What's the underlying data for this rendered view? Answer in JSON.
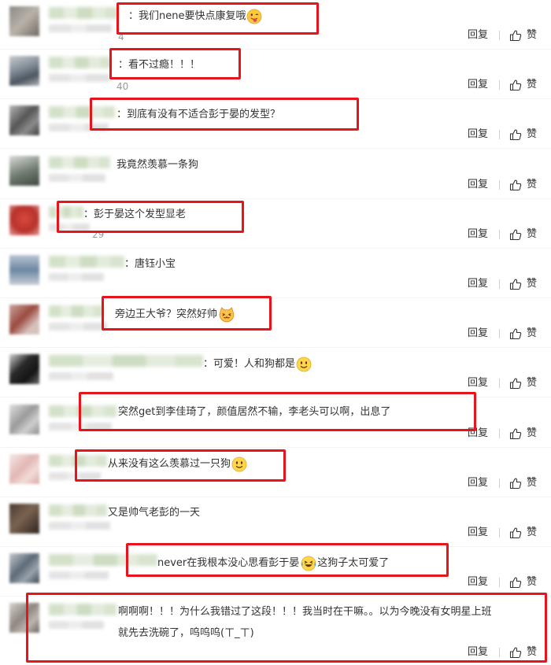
{
  "actions": {
    "reply_label": "回复",
    "like_label": "赞"
  },
  "colors": {
    "highlight": "#e8141b",
    "text": "#333333",
    "meta": "#999999"
  },
  "comments": [
    {
      "text": "：我们nene要快点康复哦",
      "emoji": "tongue-face-icon",
      "time": "4"
    },
    {
      "text": "：看不过瘾！！！",
      "time": "40"
    },
    {
      "text": "：到底有没有不适合彭于晏的发型？"
    },
    {
      "text": "我竟然羡慕一条狗"
    },
    {
      "text": "：彭于晏这个发型显老",
      "time": "29"
    },
    {
      "text": "：唐钰小宝"
    },
    {
      "text": "旁边王大爷？突然好帅",
      "emoji": "cat-face-icon"
    },
    {
      "text": "：可爱！人和狗都是",
      "emoji": "smile-icon"
    },
    {
      "text": "突然get到李佳琦了，颜值居然不输，李老头可以啊，出息了"
    },
    {
      "text": "从来没有这么羡慕过一只狗",
      "emoji": "smile-icon"
    },
    {
      "text": "又是帅气老彭的一天"
    },
    {
      "text": "never在我根本没心思看彭于晏",
      "emoji": "laugh-tears-icon",
      "text_after": "这狗子太可爱了"
    },
    {
      "text": "啊啊啊！！！为什么我错过了这段！！！我当时在干嘛。。以为今晚没有女明星上班",
      "text_line2": "就先去洗碗了，呜呜呜(ㄒ_ㄒ)"
    }
  ]
}
